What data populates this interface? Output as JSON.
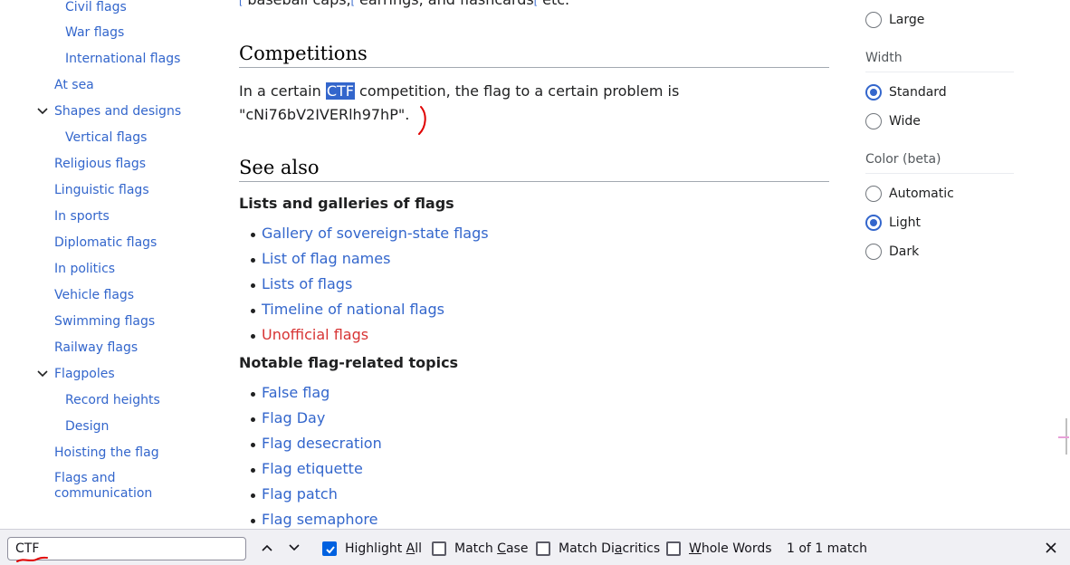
{
  "toc": {
    "items": [
      {
        "label": "Civil flags",
        "level": 2
      },
      {
        "label": "War flags",
        "level": 2
      },
      {
        "label": "International flags",
        "level": 2
      },
      {
        "label": "At sea",
        "level": 1
      },
      {
        "label": "Shapes and designs",
        "level": 1,
        "expanded": true
      },
      {
        "label": "Vertical flags",
        "level": 2
      },
      {
        "label": "Religious flags",
        "level": 1
      },
      {
        "label": "Linguistic flags",
        "level": 1
      },
      {
        "label": "In sports",
        "level": 1
      },
      {
        "label": "Diplomatic flags",
        "level": 1
      },
      {
        "label": "In politics",
        "level": 1
      },
      {
        "label": "Vehicle flags",
        "level": 1
      },
      {
        "label": "Swimming flags",
        "level": 1
      },
      {
        "label": "Railway flags",
        "level": 1
      },
      {
        "label": "Flagpoles",
        "level": 1,
        "expanded": true
      },
      {
        "label": "Record heights",
        "level": 2
      },
      {
        "label": "Design",
        "level": 2
      },
      {
        "label": "Hoisting the flag",
        "level": 1
      },
      {
        "label": "Flags and communication",
        "level": 1
      }
    ]
  },
  "article": {
    "cut_line": {
      "sup1": "[",
      "text1": " baseball caps,",
      "sup2": "[",
      "text2": " earrings, and flashcards",
      "sup3": "[",
      "text3": " etc."
    },
    "competitions_heading": "Competitions",
    "para_before": "In a certain ",
    "para_highlight": "CTF",
    "para_after": " competition, the flag to a certain problem is \"cNi76bV2IVERlh97hP\".",
    "see_also_heading": "See also",
    "lists_heading": "Lists and galleries of flags",
    "lists_links": [
      {
        "label": "Gallery of sovereign-state flags",
        "red": false
      },
      {
        "label": "List of flag names",
        "red": false
      },
      {
        "label": "Lists of flags",
        "red": false
      },
      {
        "label": "Timeline of national flags",
        "red": false
      },
      {
        "label": "Unofficial flags",
        "red": true
      }
    ],
    "topics_heading": "Notable flag-related topics",
    "topics_links": [
      {
        "label": "False flag"
      },
      {
        "label": "Flag Day"
      },
      {
        "label": "Flag desecration"
      },
      {
        "label": "Flag etiquette"
      },
      {
        "label": "Flag patch"
      },
      {
        "label": "Flag semaphore"
      }
    ]
  },
  "appearance": {
    "text_option_large": "Large",
    "width_title": "Width",
    "width_options": [
      {
        "label": "Standard",
        "selected": true
      },
      {
        "label": "Wide",
        "selected": false
      }
    ],
    "color_title": "Color (beta)",
    "color_options": [
      {
        "label": "Automatic",
        "selected": false
      },
      {
        "label": "Light",
        "selected": true
      },
      {
        "label": "Dark",
        "selected": false
      }
    ]
  },
  "findbar": {
    "query": "CTF",
    "highlight_all": {
      "pre": "Highlight ",
      "key": "A",
      "post": "ll",
      "checked": true
    },
    "match_case": {
      "pre": "Match ",
      "key": "C",
      "post": "ase",
      "checked": false
    },
    "match_diacritics": {
      "pre": "Match Di",
      "key": "a",
      "post": "critics",
      "checked": false
    },
    "whole_words": {
      "pre": "",
      "key": "W",
      "post": "hole Words",
      "checked": false
    },
    "match_count": "1 of 1 match"
  },
  "colors": {
    "link": "#3366cc",
    "redlink": "#d73333",
    "highlight": "#3366cc",
    "annotation": "#e00000",
    "checkbox_on": "#0061e0"
  },
  "icons": {
    "toc_expand": "chevron-down-icon",
    "find_prev": "chevron-up-icon",
    "find_next": "chevron-down-icon",
    "find_close": "close-icon",
    "checkbox_check": "check-icon"
  }
}
